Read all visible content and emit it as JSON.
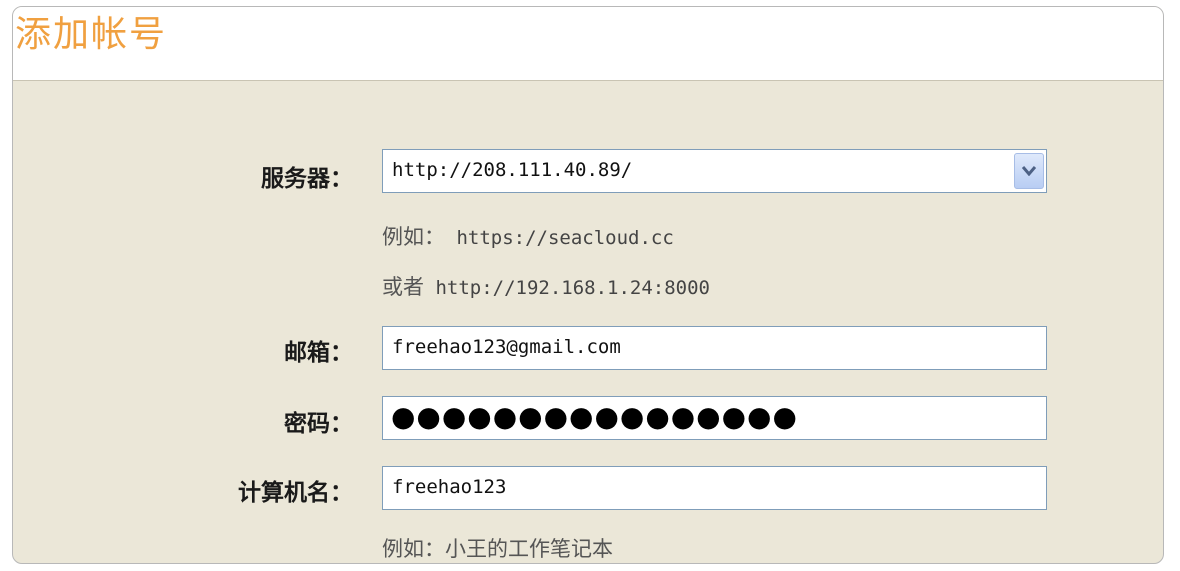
{
  "dialog": {
    "title": "添加帐号"
  },
  "form": {
    "server": {
      "label": "服务器：",
      "value": "http://208.111.40.89/",
      "hint_prefix_1": "例如：",
      "hint_example_1": " https://seacloud.cc",
      "hint_prefix_2": "或者",
      "hint_example_2": " http://192.168.1.24:8000"
    },
    "email": {
      "label": "邮箱：",
      "value": "freehao123@gmail.com"
    },
    "password": {
      "label": "密码：",
      "masked_value": "●●●●●●●●●●●●●●●●"
    },
    "computer_name": {
      "label": "计算机名：",
      "value": "freehao123",
      "hint": "例如：小王的工作笔记本"
    }
  },
  "icons": {
    "dropdown": "chevron-down-icon"
  }
}
